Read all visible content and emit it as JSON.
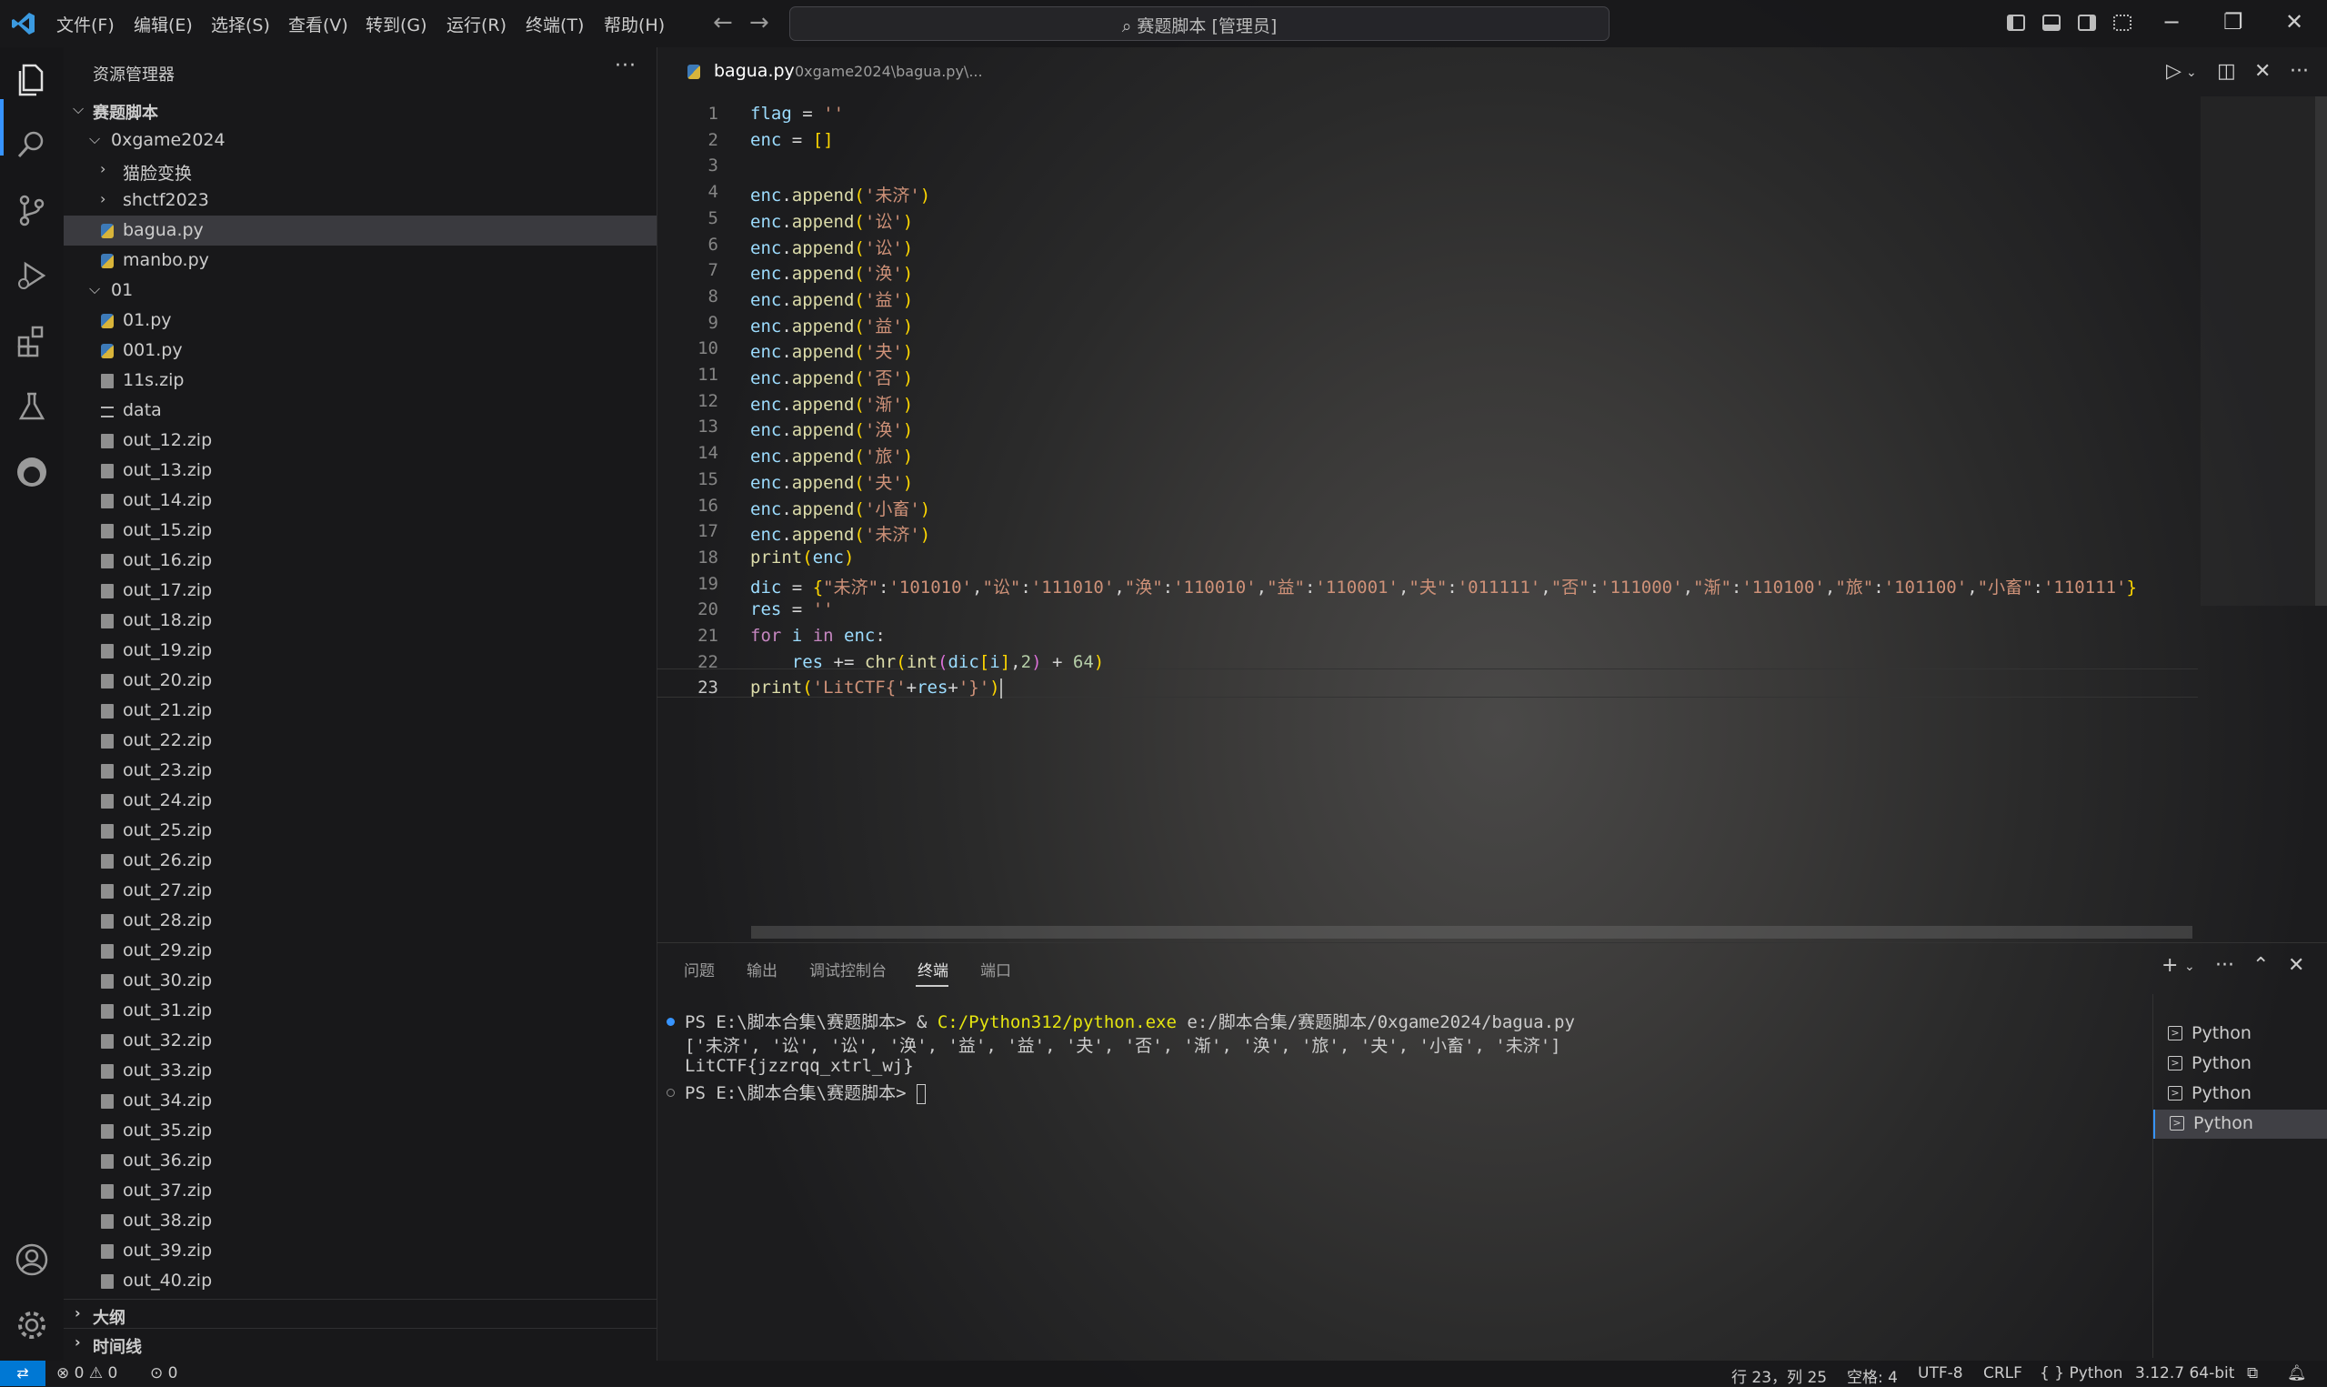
{
  "titlebar": {
    "menu": [
      "文件(F)",
      "编辑(E)",
      "选择(S)",
      "查看(V)",
      "转到(G)",
      "运行(R)",
      "终端(T)",
      "帮助(H)"
    ],
    "search_text": "赛题脚本 [管理员]"
  },
  "sidebar": {
    "title": "资源管理器",
    "root": "赛题脚本",
    "items": [
      {
        "label": "0xgame2024",
        "type": "folder-open"
      },
      {
        "label": "猫脸变换",
        "type": "folder"
      },
      {
        "label": "shctf2023",
        "type": "folder"
      },
      {
        "label": "bagua.py",
        "type": "py"
      },
      {
        "label": "manbo.py",
        "type": "py"
      },
      {
        "label": "01",
        "type": "folder-open"
      },
      {
        "label": "01.py",
        "type": "py"
      },
      {
        "label": "001.py",
        "type": "py"
      },
      {
        "label": "11s.zip",
        "type": "zip"
      },
      {
        "label": "data",
        "type": "txt"
      },
      {
        "label": "out_12.zip",
        "type": "zip"
      },
      {
        "label": "out_13.zip",
        "type": "zip"
      },
      {
        "label": "out_14.zip",
        "type": "zip"
      },
      {
        "label": "out_15.zip",
        "type": "zip"
      },
      {
        "label": "out_16.zip",
        "type": "zip"
      },
      {
        "label": "out_17.zip",
        "type": "zip"
      },
      {
        "label": "out_18.zip",
        "type": "zip"
      },
      {
        "label": "out_19.zip",
        "type": "zip"
      },
      {
        "label": "out_20.zip",
        "type": "zip"
      },
      {
        "label": "out_21.zip",
        "type": "zip"
      },
      {
        "label": "out_22.zip",
        "type": "zip"
      },
      {
        "label": "out_23.zip",
        "type": "zip"
      },
      {
        "label": "out_24.zip",
        "type": "zip"
      },
      {
        "label": "out_25.zip",
        "type": "zip"
      },
      {
        "label": "out_26.zip",
        "type": "zip"
      },
      {
        "label": "out_27.zip",
        "type": "zip"
      },
      {
        "label": "out_28.zip",
        "type": "zip"
      },
      {
        "label": "out_29.zip",
        "type": "zip"
      },
      {
        "label": "out_30.zip",
        "type": "zip"
      },
      {
        "label": "out_31.zip",
        "type": "zip"
      },
      {
        "label": "out_32.zip",
        "type": "zip"
      },
      {
        "label": "out_33.zip",
        "type": "zip"
      },
      {
        "label": "out_34.zip",
        "type": "zip"
      },
      {
        "label": "out_35.zip",
        "type": "zip"
      },
      {
        "label": "out_36.zip",
        "type": "zip"
      },
      {
        "label": "out_37.zip",
        "type": "zip"
      },
      {
        "label": "out_38.zip",
        "type": "zip"
      },
      {
        "label": "out_39.zip",
        "type": "zip"
      },
      {
        "label": "out_40.zip",
        "type": "zip"
      }
    ],
    "sections": [
      "大纲",
      "时间线"
    ]
  },
  "editor": {
    "tab_name": "bagua.py",
    "tab_path": "0xgame2024\\bagua.py\\...",
    "lines": [
      {
        "n": "1",
        "code": "flag = ''"
      },
      {
        "n": "2",
        "code": "enc = []"
      },
      {
        "n": "3",
        "code": ""
      },
      {
        "n": "4",
        "code": "enc.append('未济')"
      },
      {
        "n": "5",
        "code": "enc.append('讼')"
      },
      {
        "n": "6",
        "code": "enc.append('讼')"
      },
      {
        "n": "7",
        "code": "enc.append('涣')"
      },
      {
        "n": "8",
        "code": "enc.append('益')"
      },
      {
        "n": "9",
        "code": "enc.append('益')"
      },
      {
        "n": "10",
        "code": "enc.append('夬')"
      },
      {
        "n": "11",
        "code": "enc.append('否')"
      },
      {
        "n": "12",
        "code": "enc.append('渐')"
      },
      {
        "n": "13",
        "code": "enc.append('涣')"
      },
      {
        "n": "14",
        "code": "enc.append('旅')"
      },
      {
        "n": "15",
        "code": "enc.append('夬')"
      },
      {
        "n": "16",
        "code": "enc.append('小畜')"
      },
      {
        "n": "17",
        "code": "enc.append('未济')"
      },
      {
        "n": "18",
        "code": "print(enc)"
      },
      {
        "n": "19",
        "code": "dic = {\"未济\":'101010',\"讼\":'111010',\"涣\":'110010',\"益\":'110001',\"夬\":'011111',\"否\":'111000',\"渐\":'110100',\"旅\":'101100',\"小畜\":'110111'}"
      },
      {
        "n": "20",
        "code": "res = ''"
      },
      {
        "n": "21",
        "code": "for i in enc:"
      },
      {
        "n": "22",
        "code": "    res += chr(int(dic[i],2) + 64)"
      },
      {
        "n": "23",
        "code": "print('LitCTF{'+res+'}')"
      }
    ]
  },
  "panel": {
    "tabs": [
      "问题",
      "输出",
      "调试控制台",
      "终端",
      "端口"
    ],
    "active_tab": "终端",
    "terminal": {
      "prompt1": "PS E:\\脚本合集\\赛题脚本> & ",
      "exe": "C:/Python312/python.exe",
      "arg": " e:/脚本合集/赛题脚本/0xgame2024/bagua.py",
      "out1": "['未济', '讼', '讼', '涣', '益', '益', '夬', '否', '渐', '涣', '旅', '夬', '小畜', '未济']",
      "out2": "LitCTF{jzzrqq_xtrl_wj}",
      "prompt2": "PS E:\\脚本合集\\赛题脚本> "
    },
    "terminals": [
      "Python",
      "Python",
      "Python",
      "Python"
    ]
  },
  "statusbar": {
    "errors": "0",
    "warnings": "0",
    "ports": "0",
    "position": "行 23，列 25",
    "spaces": "空格: 4",
    "encoding": "UTF-8",
    "eol": "CRLF",
    "language": "Python",
    "interpreter": "3.12.7 64-bit"
  }
}
